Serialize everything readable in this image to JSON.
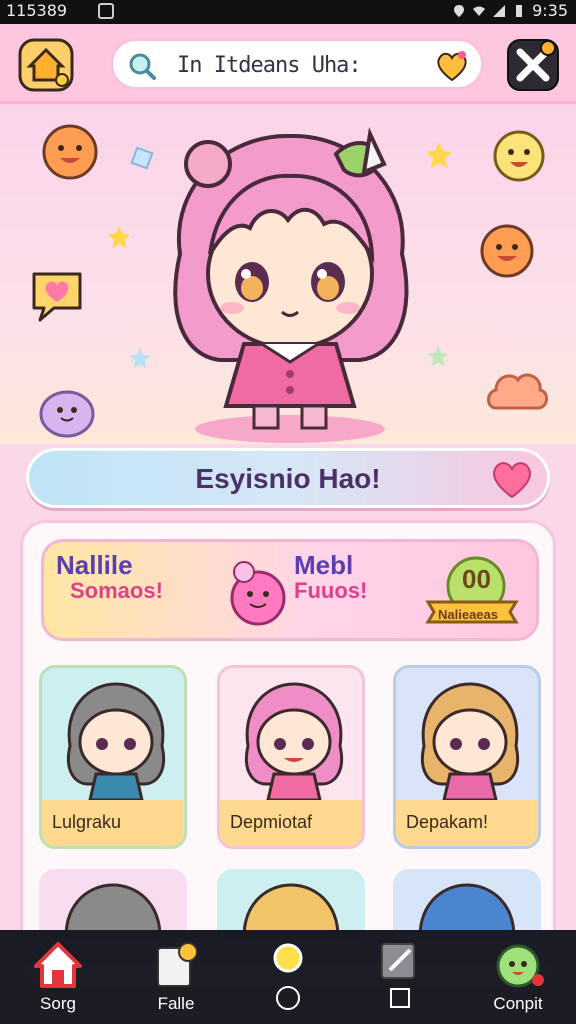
{
  "status_bar": {
    "left_text": "115389",
    "time": "9:35",
    "icons": [
      "sim-icon",
      "location-icon",
      "wifi-icon",
      "signal-icon",
      "battery-icon"
    ]
  },
  "header": {
    "home_icon": "home-icon",
    "search": {
      "text": "In Itdeans Uha:",
      "icon": "search-icon",
      "heart_icon": "heart-icon"
    },
    "close_icon": "close-icon"
  },
  "hero": {
    "character": "pink-hair-chibi-girl"
  },
  "banner": {
    "text": "Esyisnio Hao!",
    "icon": "heart-icon"
  },
  "promo": {
    "items": [
      {
        "line1": "Nallile",
        "line2": "Somaos!"
      },
      {
        "line1": "Mebl",
        "line2": "Fuuos!"
      },
      {
        "line1": "00",
        "line2": "Nalieaeas"
      }
    ]
  },
  "cards": [
    {
      "name": "Lulgraku",
      "hair": "#8a8a8a",
      "bg": "#cdeff0"
    },
    {
      "name": "Depmiotaf",
      "hair": "#f08cc6",
      "bg": "#fde5ef"
    },
    {
      "name": "Depakam!",
      "hair": "#e8b36a",
      "bg": "#dbe3f8"
    }
  ],
  "nav": [
    {
      "label": "Sorg",
      "icon": "home-icon"
    },
    {
      "label": "Falle",
      "icon": "file-icon"
    },
    {
      "label": "",
      "icon": "home-circle-icon"
    },
    {
      "label": "",
      "icon": "square-icon"
    },
    {
      "label": "Conpit",
      "icon": "avatar-icon"
    }
  ],
  "colors": {
    "accent": "#f26ea4",
    "background": "#fbd7ea",
    "panel_border": "#f7c6dd"
  }
}
